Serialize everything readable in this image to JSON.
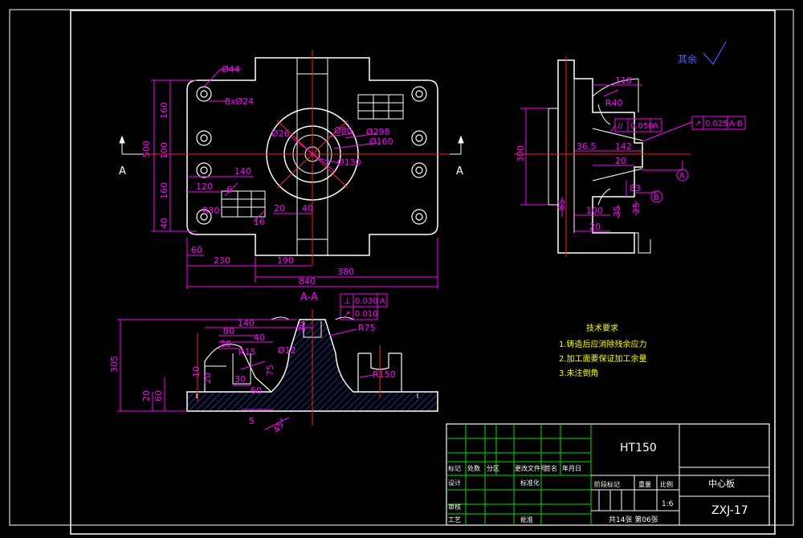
{
  "colors": {
    "background": "#000000",
    "frame": "#ffffff",
    "outline": "#ffffff",
    "dimension": "#ff00ff",
    "centerline": "#ff2020",
    "table_grid": "#00e000",
    "hatch": "#3050ff",
    "cyan": "#00ffff",
    "tolerance": "#ff00ff",
    "roughness": "#4060ff"
  },
  "front_view": {
    "dims": {
      "dia44": "Ø44",
      "holes": "8xØ24",
      "d26": "Ø26",
      "d80": "Ø80",
      "d298": "Ø298",
      "d160": "Ø160",
      "d130": "Ø130",
      "v500": "500",
      "v160a": "160",
      "v100": "100",
      "v160b": "160",
      "v40": "40",
      "h140": "140",
      "h120": "120",
      "r30": "R30",
      "n6": "6",
      "n16": "16",
      "h20": "20",
      "h40": "40",
      "h60": "60",
      "h230": "230",
      "h190": "190",
      "h380": "380",
      "h840": "840"
    },
    "section_marks": [
      "A",
      "A"
    ]
  },
  "side_view": {
    "dims": {
      "d118": "118",
      "r40": "R40",
      "v300": "300",
      "d36_5": "36.5",
      "d142": "142",
      "d20a": "20",
      "v83": "83",
      "v85": "85",
      "d100": "100",
      "v35": "35",
      "v25": "25",
      "d20b": "20"
    },
    "tolerance_parallel": {
      "symbol": "//",
      "value": "0.050",
      "datum": "A"
    },
    "tolerance_runout": {
      "symbol": "↗",
      "value": "0.025",
      "datum": "A-B"
    },
    "datum_a": "A",
    "datum_b": "B"
  },
  "roughness_note": "其余",
  "section_view": {
    "title": "A-A",
    "tolerance_1": {
      "symbol": "⊥",
      "value": "0.030",
      "datum": "A"
    },
    "tolerance_2": {
      "symbol": "↗",
      "value": "0.010"
    },
    "dims": {
      "d140": "140",
      "d80": "80",
      "d40": "40",
      "d20a": "20",
      "d30": "30",
      "r15": "R15",
      "d12": "Ø12",
      "d75": "75",
      "d60": "60",
      "d10": "10",
      "d20b": "20",
      "v305": "305",
      "v20": "20",
      "v60": "60",
      "d5": "5",
      "d45": "45°",
      "r75": "R75",
      "r150": "R150",
      "d30b": "30"
    }
  },
  "tech_requirements": {
    "title": "技术要求",
    "items": [
      "1.铸造后应消除残余应力",
      "2.加工面要保证加工余量",
      "3.未注倒角"
    ]
  },
  "title_block": {
    "material": "HT150",
    "part_name": "中心板",
    "drawing_no": "ZXJ-17",
    "scale": "1:6",
    "sheets": "共14张 第06张",
    "labels": {
      "mark": "标记",
      "count": "处数",
      "zone": "分区",
      "change_doc": "更改文件号",
      "sign": "签名",
      "date": "年月日",
      "design": "设计",
      "standardize": "标准化",
      "stage_mark": "阶段标记",
      "weight": "重量",
      "ratio": "比例",
      "review": "审核",
      "process": "工艺",
      "approve": "批准"
    }
  }
}
